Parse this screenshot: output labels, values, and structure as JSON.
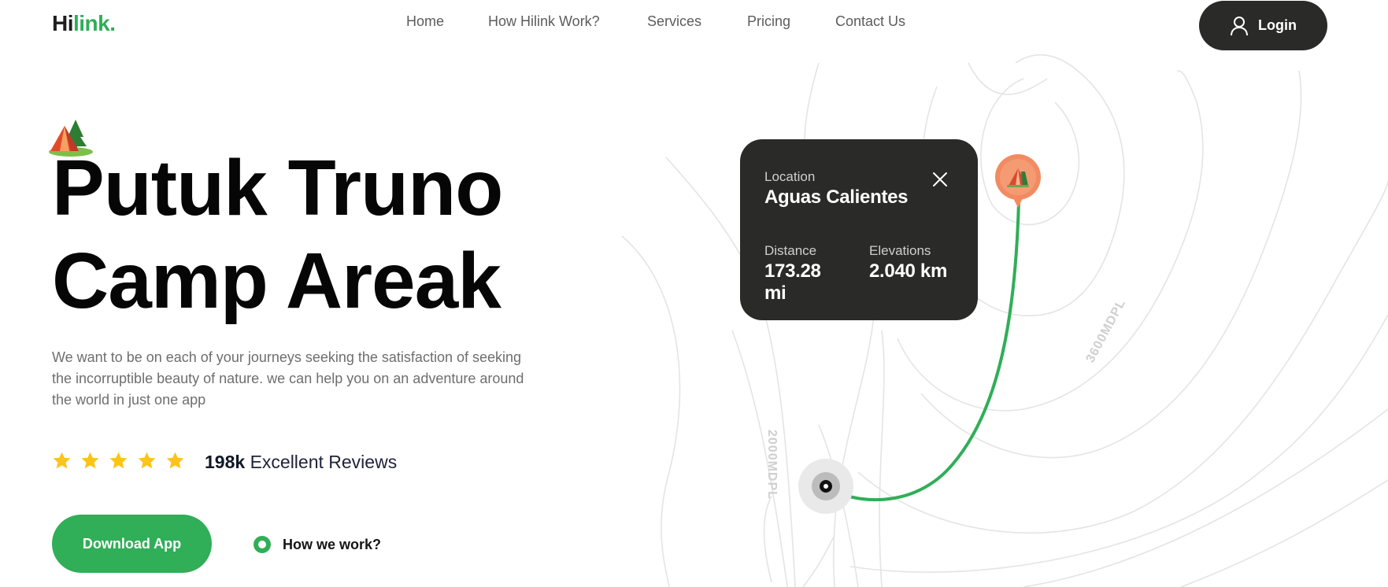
{
  "header": {
    "logo_part1": "Hi",
    "logo_part2": "link.",
    "nav": [
      "Home",
      "How Hilink Work?",
      "Services",
      "Pricing",
      "Contact Us"
    ],
    "login_label": "Login",
    "login_icon": "user-icon"
  },
  "hero": {
    "emoji_icon": "camping-tent-icon",
    "title_line1": "Putuk Truno",
    "title_line2": "Camp Areak",
    "description": "We want to be on each of your journeys seeking the satisfaction of seeking the incorruptible beauty of nature. we can help you on an adventure around the world in just one app",
    "rating_stars": 5,
    "reviews_count": "198k",
    "reviews_label": "Excellent Reviews",
    "download_label": "Download App",
    "how_work_label": "How we work?"
  },
  "map": {
    "contour_label_1": "3600MDPL",
    "contour_label_2": "2000MDPL",
    "route_color": "#30ae58",
    "pin_color": "#f28b62"
  },
  "info_card": {
    "location_label": "Location",
    "location_value": "Aguas Calientes",
    "distance_label": "Distance",
    "distance_value": "173.28 mi",
    "elevation_label": "Elevations",
    "elevation_value": "2.040 km"
  },
  "colors": {
    "brand_green": "#30ae58",
    "dark": "#2a2b28",
    "star": "#fcc419"
  }
}
